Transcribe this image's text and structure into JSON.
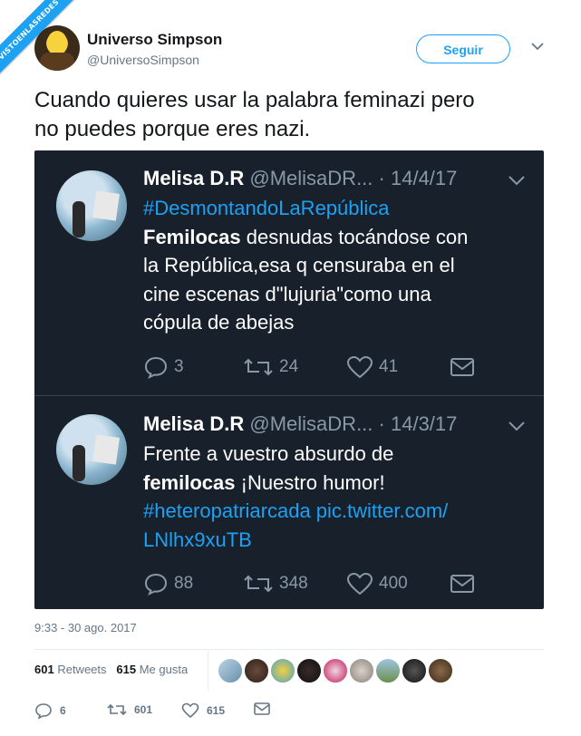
{
  "watermark": "VISTOENLASREDES",
  "author": {
    "name": "Universo Simpson",
    "handle": "@UniversoSimpson",
    "follow_label": "Seguir"
  },
  "tweet": {
    "text_line1": "Cuando quieres usar la palabra feminazi pero",
    "text_line2": "no puedes porque eres nazi.",
    "timestamp": "9:33 - 30 ago. 2017"
  },
  "quoted": [
    {
      "name": "Melisa D.R",
      "handle": "@MelisaDR...",
      "date": "· 14/4/17",
      "lines": [
        {
          "hl": "#DesmontandoLaRepública"
        },
        {
          "b": "Femilocas",
          "rest": " desnudas tocándose con"
        },
        {
          "text": "la República,esa q censuraba en el"
        },
        {
          "text": "cine escenas d\"lujuria\"como una"
        },
        {
          "text": "cópula de abejas"
        }
      ],
      "replies": "3",
      "retweets": "24",
      "likes": "41"
    },
    {
      "name": "Melisa D.R",
      "handle": "@MelisaDR...",
      "date": "· 14/3/17",
      "lines": [
        {
          "text": "Frente a vuestro absurdo de"
        },
        {
          "b": "femilocas",
          "rest": " ¡Nuestro humor!"
        },
        {
          "hl": "#heteropatriarcada pic.twitter.com/"
        },
        {
          "hl": "LNlhx9xuTB"
        }
      ],
      "replies": "88",
      "retweets": "348",
      "likes": "400"
    }
  ],
  "stats": {
    "retweets_count": "601",
    "retweets_label": "Retweets",
    "likes_count": "615",
    "likes_label": "Me gusta"
  },
  "actions": {
    "replies": "6",
    "retweets": "601",
    "likes": "615"
  },
  "colors": {
    "accent": "#1da1f2",
    "dark_bg": "#17202b",
    "muted": "#657786"
  }
}
